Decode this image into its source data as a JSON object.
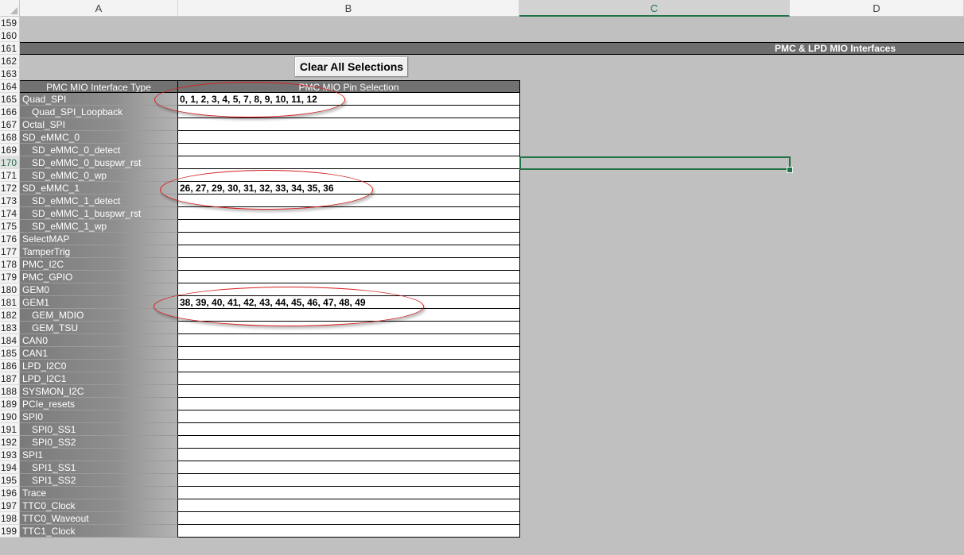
{
  "columns": [
    {
      "label": "A",
      "selected": false
    },
    {
      "label": "B",
      "selected": false
    },
    {
      "label": "C",
      "selected": true
    },
    {
      "label": "D",
      "selected": false
    }
  ],
  "banner_title": "PMC & LPD MIO Interfaces",
  "clear_button_label": "Clear All Selections",
  "table_header": {
    "col_a": "PMC MIO Interface Type",
    "col_b": "PMC MIO Pin Selection"
  },
  "empty_rows": [
    "159",
    "160"
  ],
  "banner_row": "161",
  "button_rows": [
    "162",
    "163"
  ],
  "header_row": "164",
  "selected_row": "170",
  "rows": [
    {
      "num": "165",
      "name": "Quad_SPI",
      "indent": false,
      "pins": "0, 1, 2, 3, 4, 5, 7, 8, 9, 10, 11, 12"
    },
    {
      "num": "166",
      "name": "Quad_SPI_Loopback",
      "indent": true,
      "pins": ""
    },
    {
      "num": "167",
      "name": "Octal_SPI",
      "indent": false,
      "pins": ""
    },
    {
      "num": "168",
      "name": "SD_eMMC_0",
      "indent": false,
      "pins": ""
    },
    {
      "num": "169",
      "name": "SD_eMMC_0_detect",
      "indent": true,
      "pins": ""
    },
    {
      "num": "170",
      "name": "SD_eMMC_0_buspwr_rst",
      "indent": true,
      "pins": ""
    },
    {
      "num": "171",
      "name": "SD_eMMC_0_wp",
      "indent": true,
      "pins": ""
    },
    {
      "num": "172",
      "name": "SD_eMMC_1",
      "indent": false,
      "pins": "26, 27, 29, 30, 31, 32, 33, 34, 35, 36"
    },
    {
      "num": "173",
      "name": "SD_eMMC_1_detect",
      "indent": true,
      "pins": ""
    },
    {
      "num": "174",
      "name": "SD_eMMC_1_buspwr_rst",
      "indent": true,
      "pins": ""
    },
    {
      "num": "175",
      "name": "SD_eMMC_1_wp",
      "indent": true,
      "pins": ""
    },
    {
      "num": "176",
      "name": "SelectMAP",
      "indent": false,
      "pins": ""
    },
    {
      "num": "177",
      "name": "TamperTrig",
      "indent": false,
      "pins": ""
    },
    {
      "num": "178",
      "name": "PMC_I2C",
      "indent": false,
      "pins": ""
    },
    {
      "num": "179",
      "name": "PMC_GPIO",
      "indent": false,
      "pins": ""
    },
    {
      "num": "180",
      "name": "GEM0",
      "indent": false,
      "pins": ""
    },
    {
      "num": "181",
      "name": "GEM1",
      "indent": false,
      "pins": "38, 39, 40, 41, 42, 43, 44, 45, 46, 47, 48, 49"
    },
    {
      "num": "182",
      "name": "GEM_MDIO",
      "indent": true,
      "pins": ""
    },
    {
      "num": "183",
      "name": "GEM_TSU",
      "indent": true,
      "pins": ""
    },
    {
      "num": "184",
      "name": "CAN0",
      "indent": false,
      "pins": ""
    },
    {
      "num": "185",
      "name": "CAN1",
      "indent": false,
      "pins": ""
    },
    {
      "num": "186",
      "name": "LPD_I2C0",
      "indent": false,
      "pins": ""
    },
    {
      "num": "187",
      "name": "LPD_I2C1",
      "indent": false,
      "pins": ""
    },
    {
      "num": "188",
      "name": "SYSMON_I2C",
      "indent": false,
      "pins": ""
    },
    {
      "num": "189",
      "name": "PCIe_resets",
      "indent": false,
      "pins": ""
    },
    {
      "num": "190",
      "name": "SPI0",
      "indent": false,
      "pins": ""
    },
    {
      "num": "191",
      "name": "SPI0_SS1",
      "indent": true,
      "pins": ""
    },
    {
      "num": "192",
      "name": "SPI0_SS2",
      "indent": true,
      "pins": ""
    },
    {
      "num": "193",
      "name": "SPI1",
      "indent": false,
      "pins": ""
    },
    {
      "num": "194",
      "name": "SPI1_SS1",
      "indent": true,
      "pins": ""
    },
    {
      "num": "195",
      "name": "SPI1_SS2",
      "indent": true,
      "pins": ""
    },
    {
      "num": "196",
      "name": "Trace",
      "indent": false,
      "pins": ""
    },
    {
      "num": "197",
      "name": "TTC0_Clock",
      "indent": false,
      "pins": ""
    },
    {
      "num": "198",
      "name": "TTC0_Waveout",
      "indent": false,
      "pins": ""
    },
    {
      "num": "199",
      "name": "TTC1_Clock",
      "indent": false,
      "pins": ""
    }
  ],
  "colors": {
    "accent": "#217346",
    "annotation": "#d81e1e"
  }
}
